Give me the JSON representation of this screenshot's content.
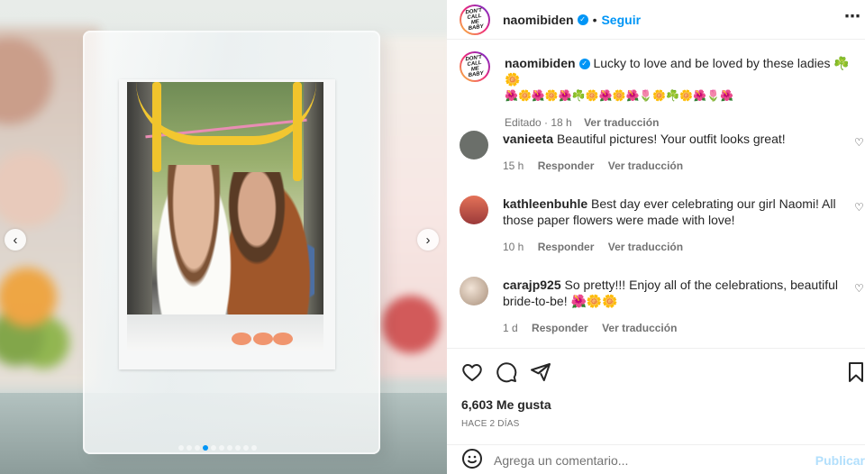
{
  "post": {
    "username": "naomibiden",
    "follow_label": "Seguir",
    "logo_text": "DON'T CALL ME BABY",
    "caption_text": "Lucky to love and be loved by these ladies ☘️🌼",
    "caption_emoji": "🌺🌼🌺🌼🌺☘️🌼🌺🌼🌺🌷🌼☘️🌼🌺🌷🌺",
    "edited_label": "Editado · 18 h",
    "translate_label": "Ver traducción"
  },
  "comments": [
    {
      "username": "vanieeta",
      "text": "Beautiful pictures! Your outfit looks great!",
      "time": "15 h",
      "reply_label": "Responder",
      "translate_label": "Ver traducción",
      "avatar_color": "#6b6f6a"
    },
    {
      "username": "kathleenbuhle",
      "text": "Best day ever celebrating our girl Naomi! All those paper flowers were made with love!",
      "time": "10 h",
      "reply_label": "Responder",
      "translate_label": "Ver traducción",
      "avatar_color": "#c5584a"
    },
    {
      "username": "carajp925",
      "text": "So pretty!!! Enjoy all of the celebrations, beautiful bride-to-be! 🌺🌼🌼",
      "time": "1 d",
      "reply_label": "Responder",
      "translate_label": "Ver traducción",
      "avatar_color": "#c9b6a4"
    }
  ],
  "actions": {
    "likes": "6,603 Me gusta",
    "time_ago": "HACE 2 DÍAS"
  },
  "add_comment": {
    "placeholder": "Agrega un comentario...",
    "publish_label": "Publicar"
  },
  "carousel": {
    "slide_count": 10,
    "active_index": 3,
    "prev_icon": "chevron-left-icon",
    "next_icon": "chevron-right-icon"
  },
  "colors": {
    "accent": "#0095f6",
    "publish_disabled": "#b2dffc"
  }
}
